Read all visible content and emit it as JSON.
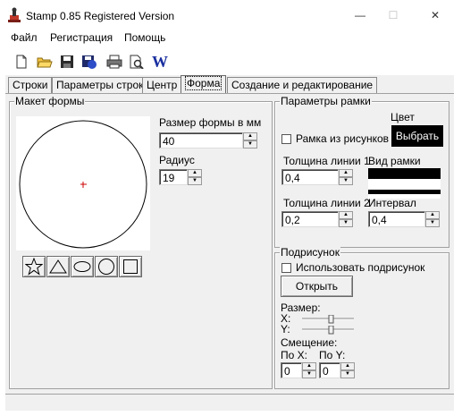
{
  "window": {
    "title": "Stamp 0.85 Registered Version",
    "controls": {
      "minimize": "—",
      "maximize": "☐",
      "close": "✕"
    }
  },
  "menu": {
    "items": [
      "Файл",
      "Регистрация",
      "Помощь"
    ]
  },
  "toolbar": {
    "buttons": [
      "new-document-icon",
      "open-folder-icon",
      "save-icon",
      "save-all-icon",
      "print-icon",
      "print-preview-icon",
      "word-export-icon"
    ],
    "word_label": "W"
  },
  "tabs": [
    {
      "label": "Строки",
      "active": false
    },
    {
      "label": "Параметры строк",
      "active": false
    },
    {
      "label": "Центр",
      "active": false
    },
    {
      "label": "Форма",
      "active": true
    },
    {
      "label": "Создание и редактирование",
      "active": false
    }
  ],
  "layout_group": {
    "title": "Макет формы",
    "size_label": "Размер формы в мм",
    "size_value": "40",
    "radius_label": "Радиус",
    "radius_value": "19",
    "shapes": [
      "star-shape-icon",
      "triangle-shape-icon",
      "ellipse-shape-icon",
      "circle-shape-icon",
      "square-shape-icon"
    ]
  },
  "frame_group": {
    "title": "Параметры рамки",
    "color_label": "Цвет",
    "from_pictures_label": "Рамка из рисунков",
    "choose_button": "Выбрать",
    "line1_label": "Толщина линии 1",
    "line1_value": "0,4",
    "frame_view_label": "Вид рамки",
    "line2_label": "Толщина линии 2",
    "line2_value": "0,2",
    "interval_label": "Интервал",
    "interval_value": "0,4"
  },
  "signature_group": {
    "title": "Подрисунок",
    "use_label": "Использовать подрисунок",
    "open_button": "Открыть",
    "size_label": "Размер:",
    "x_label": "X:",
    "y_label": "Y:",
    "offset_label": "Смещение:",
    "offset_x_label": "По X:",
    "offset_y_label": "По Y:",
    "offset_x_value": "0",
    "offset_y_value": "0"
  },
  "colors": {
    "center_marker": "#cc0000",
    "choose_button_bg": "#000000",
    "choose_button_text": "#ffffff",
    "word_icon": "#1a2fa0"
  }
}
